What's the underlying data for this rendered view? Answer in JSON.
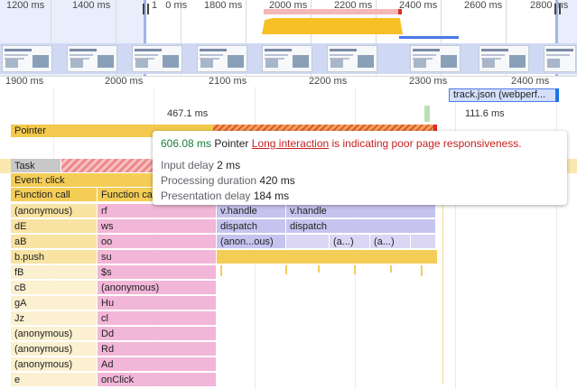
{
  "overview": {
    "ticks": [
      "1200 ms",
      "1400 ms",
      "1   0 ms",
      "1800 ms",
      "2000 ms",
      "2200 ms",
      "2400 ms",
      "2600 ms",
      "2800 ms"
    ]
  },
  "ruler": {
    "ticks": [
      "1900 ms",
      "2000 ms",
      "2100 ms",
      "2200 ms",
      "2300 ms",
      "2400 ms"
    ]
  },
  "track": {
    "label": "track.json (webperf..."
  },
  "durations": {
    "left": "467.1 ms",
    "right": "111.6 ms"
  },
  "pointer": {
    "label": "Pointer"
  },
  "tooltip": {
    "duration": "606.08 ms",
    "kind": "Pointer",
    "link": "Long interaction",
    "message": "is indicating poor page responsiveness.",
    "input_delay_label": "Input delay",
    "input_delay_value": "2 ms",
    "processing_label": "Processing duration",
    "processing_value": "420 ms",
    "presentation_label": "Presentation delay",
    "presentation_value": "184 ms"
  },
  "flame": {
    "task": "Task",
    "event": "Event: click",
    "fc1": "Function call",
    "fc2": "Function ca",
    "col1": [
      "(anonymous)",
      "dE",
      "aB",
      "b.push",
      "fB",
      "cB",
      "gA",
      "Jz",
      "(anonymous)",
      "(anonymous)",
      "(anonymous)",
      "e"
    ],
    "col2": [
      "rf",
      "ws",
      "oo",
      "su",
      "$s",
      "(anonymous)",
      "Hu",
      "cl",
      "Dd",
      "Rd",
      "Ad",
      "onClick"
    ],
    "col3": [
      "v.handle",
      "dispatch",
      "(anon...ous)"
    ],
    "col4": [
      "v.handle",
      "dispatch",
      "(a...)"
    ],
    "col5": [
      "(a...)"
    ]
  },
  "colors": {
    "accent": "#1a73e8",
    "good": "#188038",
    "bad": "#c5221f",
    "scripting": "#f4cd57",
    "pink": "#f2b6d8",
    "purple": "#c6c4ef"
  }
}
